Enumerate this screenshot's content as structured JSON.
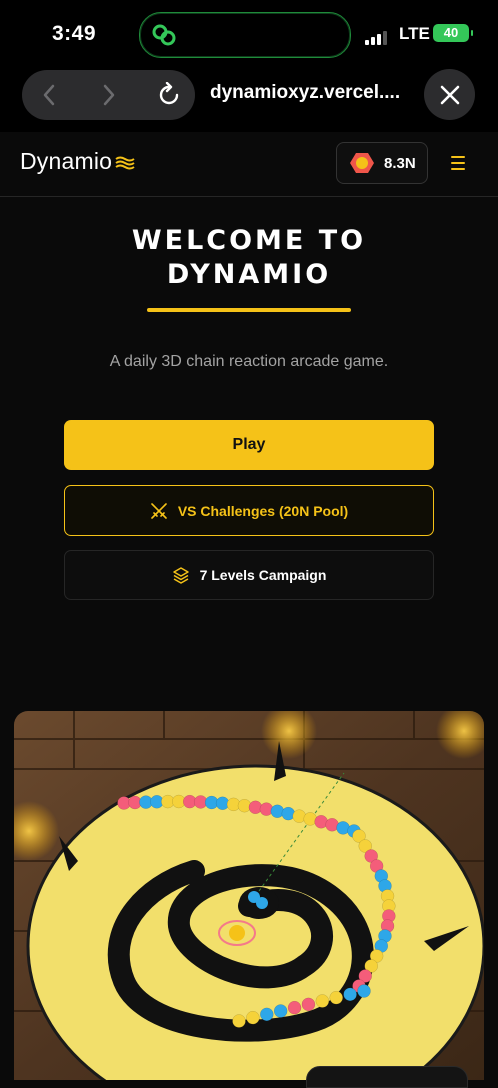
{
  "status_bar": {
    "time": "3:49",
    "network": "LTE",
    "battery": "40"
  },
  "browser": {
    "url": "dynamioxyz.vercel...."
  },
  "header": {
    "logo_text": "Dynamio",
    "balance": "8.3N"
  },
  "hero": {
    "title_line1": "WELCOME TO",
    "title_line2": "DYNAMIO",
    "subtitle": "A daily 3D chain reaction arcade game."
  },
  "buttons": {
    "play": "Play",
    "vs": "VS Challenges (20N Pool)",
    "campaign": "7 Levels Campaign"
  },
  "colors": {
    "accent": "#f5c218",
    "background": "#0a0a0a",
    "board": "#f2df6b"
  },
  "icons": [
    "link-icon",
    "back-icon",
    "forward-icon",
    "reload-icon",
    "close-icon",
    "wave-icon",
    "hexagon-coin-icon",
    "hamburger-menu-icon",
    "swords-icon",
    "layers-icon"
  ]
}
